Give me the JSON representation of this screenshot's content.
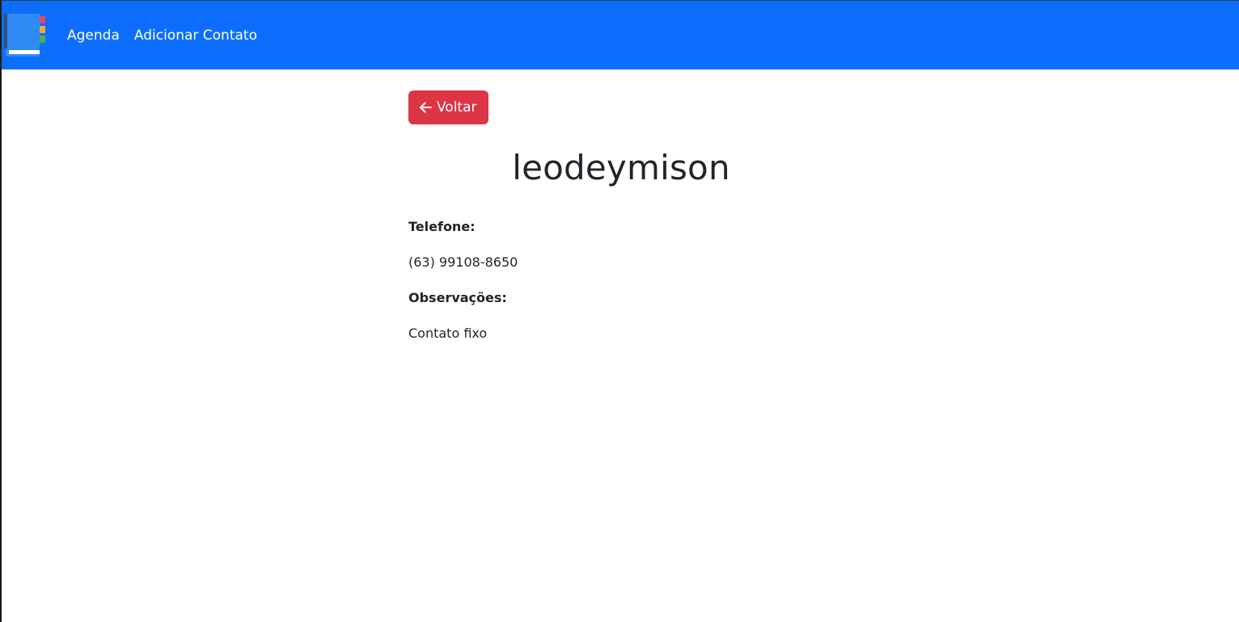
{
  "navbar": {
    "logo_icon": "address-book-icon",
    "links": [
      {
        "label": "Agenda"
      },
      {
        "label": "Adicionar Contato"
      }
    ],
    "bg_color": "#0d6efd"
  },
  "back_button": {
    "icon": "arrow-left-icon",
    "label": "Voltar",
    "color": "#dc3545"
  },
  "contact": {
    "name": "leodeymison",
    "phone_label": "Telefone:",
    "phone": "(63) 99108-8650",
    "notes_label": "Observações:",
    "notes": "Contato fixo"
  }
}
